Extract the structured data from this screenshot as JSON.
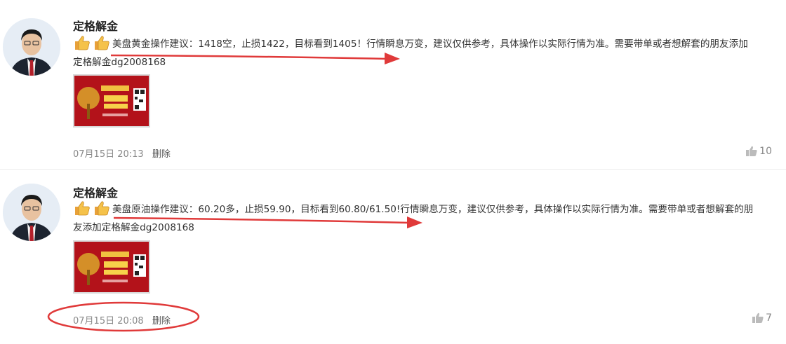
{
  "posts": [
    {
      "author": "定格解金",
      "text_line1": "美盘黄金操作建议：1418空，止损1422，目标看到1405！行情瞬息万变，建议仅供参考，具体操作以实际行情为准。需要带单或者想解套的朋友添加",
      "text_line2": "定格解金dg2008168",
      "timestamp": "07月15日 20:13",
      "delete_label": "删除",
      "likes": "10"
    },
    {
      "author": "定格解金",
      "text_line1": "美盘原油操作建议：60.20多，止损59.90，目标看到60.80/61.50!行情瞬息万变，建议仅供参考，具体操作以实际行情为准。需要带单或者想解套的朋",
      "text_line2": "友添加定格解金dg2008168",
      "timestamp": "07月15日 20:08",
      "delete_label": "删除",
      "likes": "7"
    }
  ],
  "icons": {
    "avatar": "avatar",
    "emoji": "thumbs-up-icon",
    "like": "like-icon"
  },
  "colors": {
    "annotation_red": "#e03a3a",
    "ad_red": "#b3121a"
  }
}
